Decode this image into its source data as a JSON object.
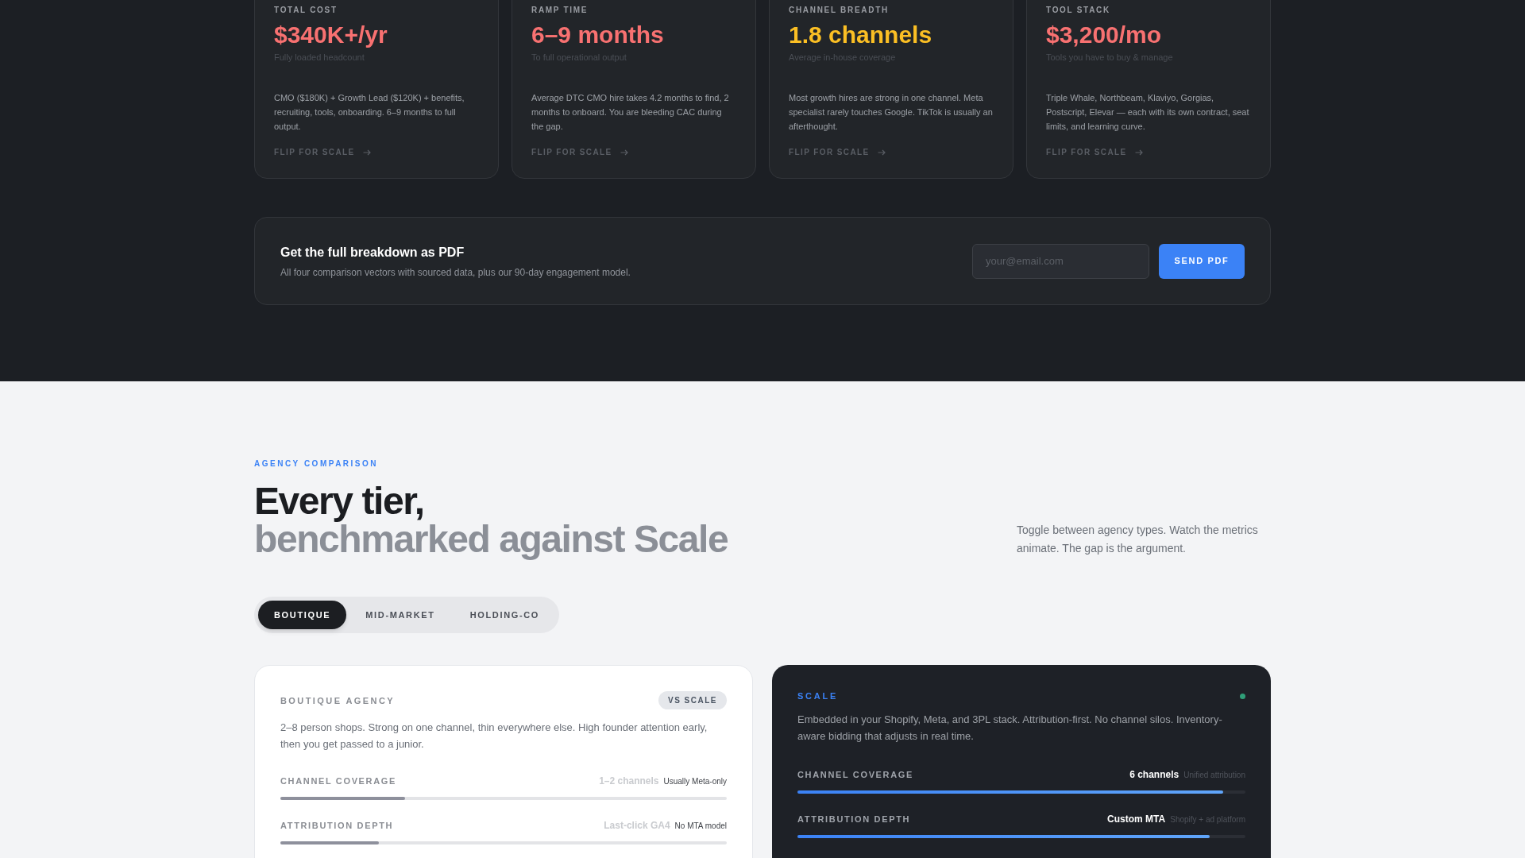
{
  "stat_cards": [
    {
      "label": "TOTAL COST",
      "value": "$340K+/yr",
      "color": "#f87171",
      "caption": "Fully loaded headcount",
      "description": "CMO ($180K) + Growth Lead ($120K) + benefits, recruiting, tools, onboarding. 6–9 months to full output.",
      "action": "FLIP FOR SCALE"
    },
    {
      "label": "RAMP TIME",
      "value": "6–9 months",
      "color": "#f87171",
      "caption": "To full operational output",
      "description": "Average DTC CMO hire takes 4.2 months to find, 2 months to onboard. You are bleeding CAC during the gap.",
      "action": "FLIP FOR SCALE"
    },
    {
      "label": "CHANNEL BREADTH",
      "value": "1.8 channels",
      "color": "#fbbf24",
      "caption": "Average in-house coverage",
      "description": "Most growth hires are strong in one channel. Meta specialist rarely touches Google. TikTok is usually an afterthought.",
      "action": "FLIP FOR SCALE"
    },
    {
      "label": "TOOL STACK",
      "value": "$3,200/mo",
      "color": "#f87171",
      "caption": "Tools you have to buy & manage",
      "description": "Triple Whale, Northbeam, Klaviyo, Gorgias, Postscript, Elevar — each with its own contract, seat limits, and learning curve.",
      "action": "FLIP FOR SCALE"
    }
  ],
  "pdf_banner": {
    "title": "Get the full breakdown as PDF",
    "subtitle": "All four comparison vectors with sourced data, plus our 90-day engagement model.",
    "email_field": {
      "placeholder": "your@email.com"
    },
    "button": "SEND PDF"
  },
  "comparison": {
    "eyebrow": "AGENCY COMPARISON",
    "heading": {
      "lead": "Every tier,",
      "rest": "benchmarked against Scale"
    },
    "intro": "Toggle between agency types. Watch the metrics animate. The gap is the argument.",
    "tabs": [
      {
        "label": "BOUTIQUE",
        "selected": true
      },
      {
        "label": "MID-MARKET",
        "selected": false
      },
      {
        "label": "HOLDING-CO",
        "selected": false
      }
    ],
    "agency_card": {
      "title": "BOUTIQUE AGENCY",
      "badge": "VS SCALE",
      "description": "2–8 person shops. Strong on one channel, thin everywhere else. High founder attention early, then you get passed to a junior.",
      "metrics": [
        {
          "label": "CHANNEL COVERAGE",
          "value": "1–2 channels",
          "note": "Usually Meta-only",
          "level": 0.28
        },
        {
          "label": "ATTRIBUTION DEPTH",
          "value": "Last-click GA4",
          "note": "No MTA model",
          "level": 0.22
        }
      ]
    },
    "scale_card": {
      "title": "SCALE",
      "description": "Embedded in your Shopify, Meta, and 3PL stack. Attribution-first. No channel silos. Inventory-aware bidding that adjusts in real time.",
      "metrics": [
        {
          "label": "CHANNEL COVERAGE",
          "value": "6 channels",
          "note": "Unified attribution",
          "level": 0.95
        },
        {
          "label": "ATTRIBUTION DEPTH",
          "value": "Custom MTA",
          "note": "Shopify + ad platform",
          "level": 0.92
        }
      ]
    }
  }
}
